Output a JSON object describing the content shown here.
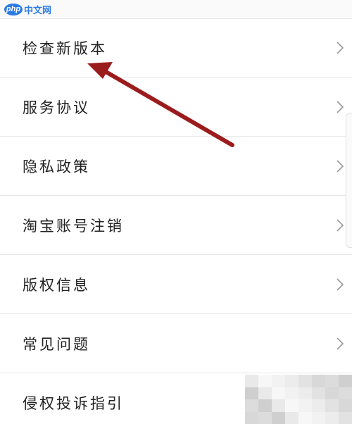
{
  "watermark": {
    "logo": "php",
    "text": "中文网"
  },
  "settings_list": {
    "items": [
      {
        "label": "检查新版本"
      },
      {
        "label": "服务协议"
      },
      {
        "label": "隐私政策"
      },
      {
        "label": "淘宝账号注销"
      },
      {
        "label": "版权信息"
      },
      {
        "label": "常见问题"
      },
      {
        "label": "侵权投诉指引"
      }
    ]
  },
  "colors": {
    "annotation_arrow": "#9b1c1c",
    "chevron": "#9a9a9a",
    "divider": "#e6e6e6",
    "watermark": "#2c7be5"
  },
  "icons": {
    "row_chevron": "chevron-right-icon",
    "annotation": "red-arrow-annotation"
  }
}
